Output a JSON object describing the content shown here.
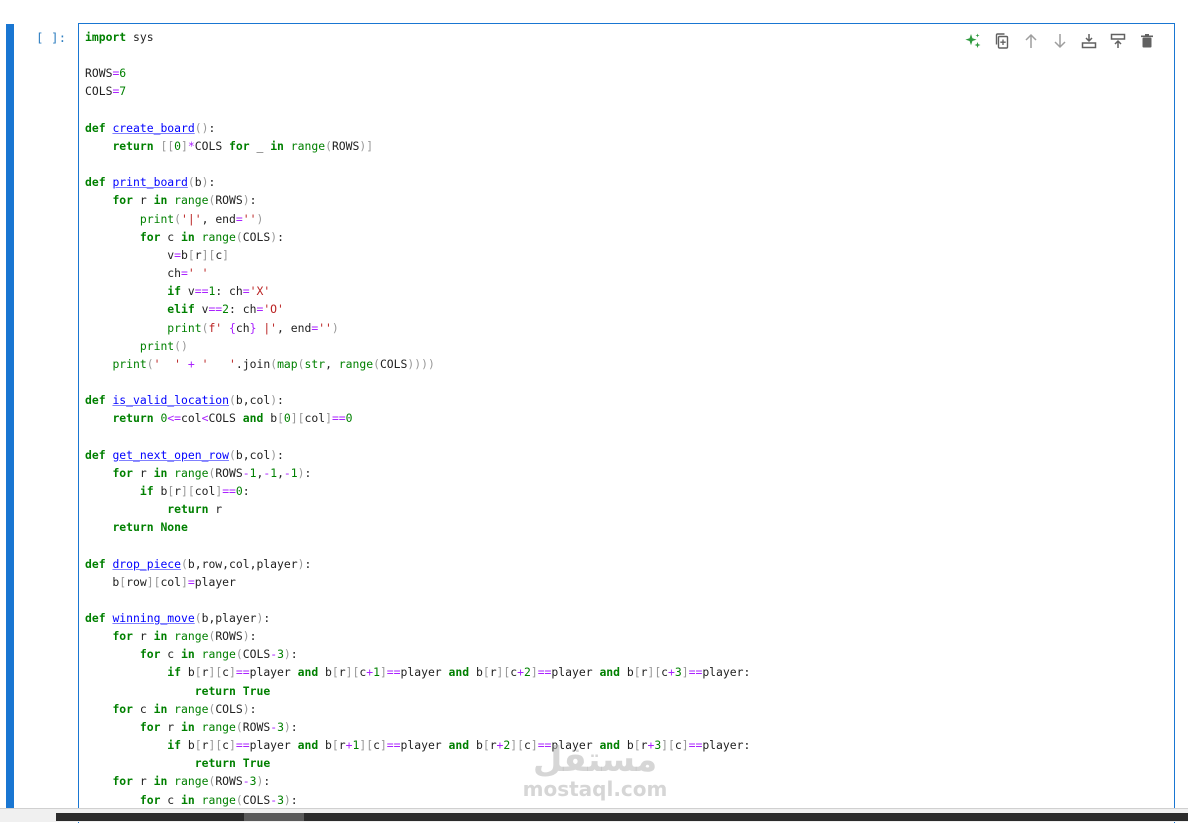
{
  "cell": {
    "prompt": "[ ]:",
    "code_lines": [
      "import sys",
      "",
      "ROWS=6",
      "COLS=7",
      "",
      "def create_board():",
      "    return [[0]*COLS for _ in range(ROWS)]",
      "",
      "def print_board(b):",
      "    for r in range(ROWS):",
      "        print('|', end='')",
      "        for c in range(COLS):",
      "            v=b[r][c]",
      "            ch=' '",
      "            if v==1: ch='X'",
      "            elif v==2: ch='O'",
      "            print(f' {ch} |', end='')",
      "        print()",
      "    print('  ' + '   '.join(map(str, range(COLS))))",
      "",
      "def is_valid_location(b,col):",
      "    return 0<=col<COLS and b[0][col]==0",
      "",
      "def get_next_open_row(b,col):",
      "    for r in range(ROWS-1,-1,-1):",
      "        if b[r][col]==0:",
      "            return r",
      "    return None",
      "",
      "def drop_piece(b,row,col,player):",
      "    b[row][col]=player",
      "",
      "def winning_move(b,player):",
      "    for r in range(ROWS):",
      "        for c in range(COLS-3):",
      "            if b[r][c]==player and b[r][c+1]==player and b[r][c+2]==player and b[r][c+3]==player:",
      "                return True",
      "    for c in range(COLS):",
      "        for r in range(ROWS-3):",
      "            if b[r][c]==player and b[r+1][c]==player and b[r+2][c]==player and b[r+3][c]==player:",
      "                return True",
      "    for r in range(ROWS-3):",
      "        for c in range(COLS-3):"
    ]
  },
  "toolbar": {
    "icons": [
      "sparkle-icon",
      "duplicate-icon",
      "arrow-up-icon",
      "arrow-down-icon",
      "insert-above-icon",
      "insert-below-icon",
      "trash-icon"
    ]
  },
  "watermark": {
    "logo": "مستقل",
    "text": "mostaql.com"
  },
  "colors": {
    "accent": "#1976d2",
    "keyword": "#008000",
    "function": "#0000ff",
    "string": "#ba2121",
    "operator": "#aa22ff"
  }
}
